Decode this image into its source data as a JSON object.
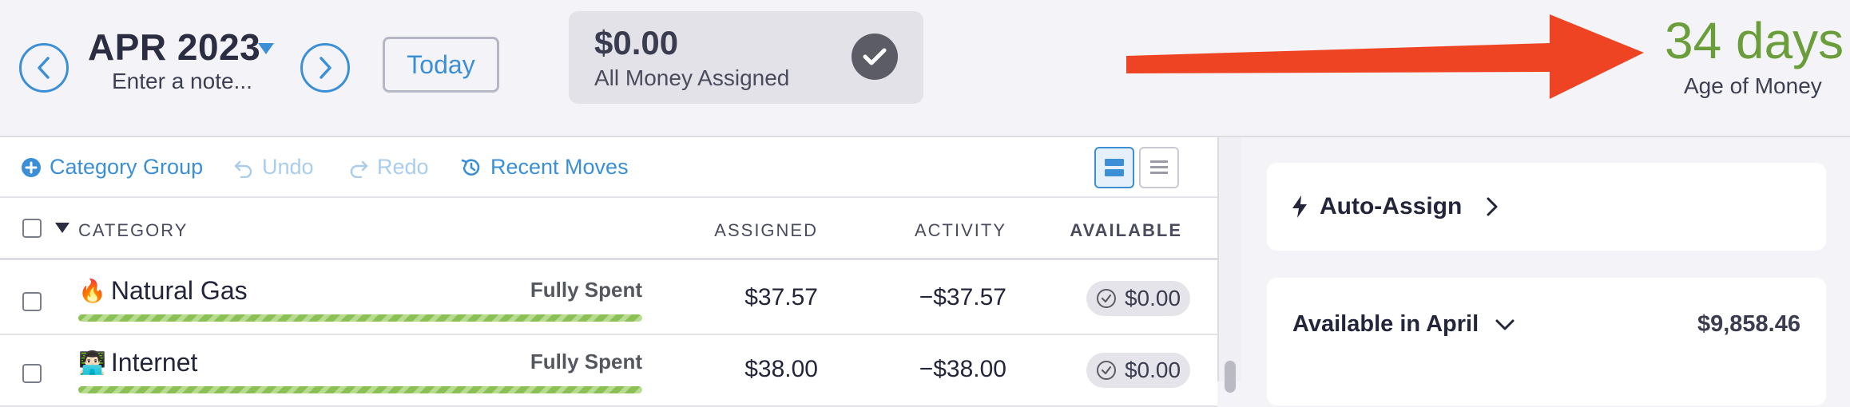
{
  "header": {
    "month": "APR 2023",
    "note_placeholder": "Enter a note...",
    "today_label": "Today",
    "assigned_amount": "$0.00",
    "assigned_label": "All Money Assigned",
    "age_of_money_value": "34 days",
    "age_of_money_label": "Age of Money"
  },
  "toolbar": {
    "category_group": "Category Group",
    "undo": "Undo",
    "redo": "Redo",
    "recent_moves": "Recent Moves"
  },
  "table": {
    "columns": {
      "category": "CATEGORY",
      "assigned": "ASSIGNED",
      "activity": "ACTIVITY",
      "available": "AVAILABLE"
    },
    "rows": [
      {
        "emoji": "🔥",
        "name": "Natural Gas",
        "status": "Fully Spent",
        "progress": 1.0,
        "assigned": "$37.57",
        "activity": "−$37.57",
        "available": "$0.00"
      },
      {
        "emoji": "👨🏻‍💻",
        "name": "Internet",
        "status": "Fully Spent",
        "progress": 1.0,
        "assigned": "$38.00",
        "activity": "−$38.00",
        "available": "$0.00"
      }
    ]
  },
  "inspector": {
    "auto_assign_label": "Auto-Assign",
    "available_title": "Available in April",
    "available_amount": "$9,858.46"
  },
  "colors": {
    "accent": "#3b8fd6",
    "age_of_money": "#6a9e3a",
    "annotation_arrow": "#ef4424",
    "progress_green": "#8ac054"
  }
}
